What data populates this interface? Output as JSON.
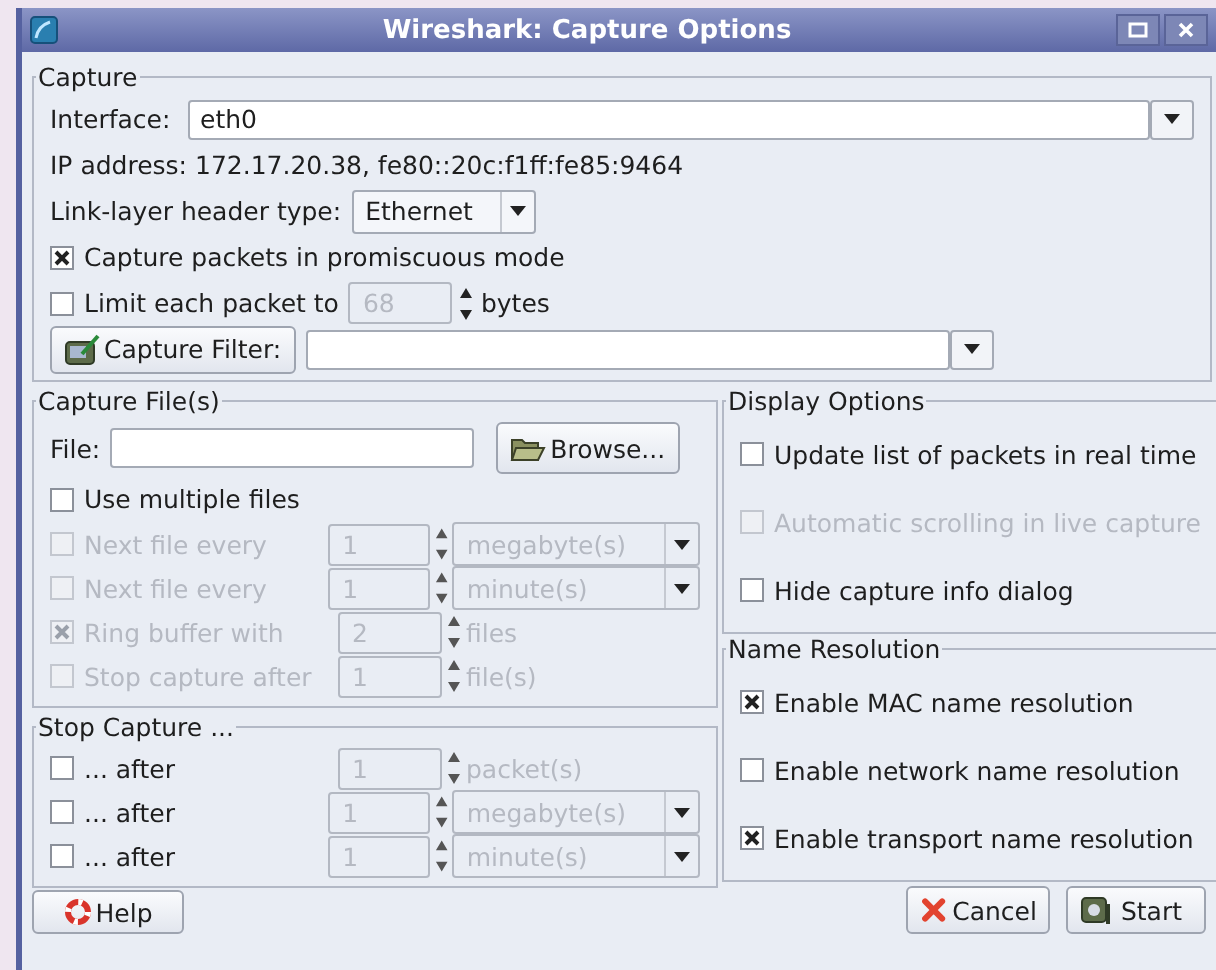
{
  "window": {
    "title": "Wireshark: Capture Options"
  },
  "capture": {
    "legend": "Capture",
    "interface": {
      "label": "Interface:",
      "value": "eth0"
    },
    "ip_address": "IP address: 172.17.20.38, fe80::20c:f1ff:fe85:9464",
    "link_layer": {
      "label": "Link-layer header type:",
      "value": "Ethernet"
    },
    "promiscuous": {
      "label": "Capture packets in promiscuous mode",
      "checked": true
    },
    "limit": {
      "label": "Limit each packet to",
      "checked": false,
      "value": "68",
      "value_disabled": true,
      "unit": "bytes"
    },
    "filter": {
      "button": "Capture Filter:"
    }
  },
  "capture_files": {
    "legend": "Capture File(s)",
    "file": {
      "label": "File:",
      "button": "Browse..."
    },
    "multiple": {
      "label": "Use multiple files",
      "checked": false
    },
    "rows": [
      {
        "label": "Next file every",
        "checked": false,
        "disabled": true,
        "value": "1",
        "unit": {
          "kind": "combo",
          "text": "megabyte(s)"
        }
      },
      {
        "label": "Next file every",
        "checked": false,
        "disabled": true,
        "value": "1",
        "unit": {
          "kind": "combo",
          "text": "minute(s)"
        }
      },
      {
        "label": "Ring buffer with",
        "checked": true,
        "disabled": true,
        "value": "2",
        "unit": {
          "kind": "text",
          "text": "files"
        }
      },
      {
        "label": "Stop capture after",
        "checked": false,
        "disabled": true,
        "value": "1",
        "unit": {
          "kind": "text",
          "text": "file(s)"
        }
      }
    ]
  },
  "stop_capture": {
    "legend": "Stop Capture ...",
    "rows": [
      {
        "label": "... after",
        "checked": false,
        "disabled": false,
        "value": "1",
        "unit": {
          "kind": "text",
          "text": "packet(s)"
        }
      },
      {
        "label": "... after",
        "checked": false,
        "disabled": false,
        "value": "1",
        "unit": {
          "kind": "combo",
          "text": "megabyte(s)"
        }
      },
      {
        "label": "... after",
        "checked": false,
        "disabled": false,
        "value": "1",
        "unit": {
          "kind": "combo",
          "text": "minute(s)"
        }
      }
    ]
  },
  "display_options": {
    "legend": "Display Options",
    "items": [
      {
        "label": "Update list of packets in real time",
        "checked": false,
        "disabled": false
      },
      {
        "label": "Automatic scrolling in live capture",
        "checked": false,
        "disabled": true
      },
      {
        "label": "Hide capture info dialog",
        "checked": false,
        "disabled": false
      }
    ]
  },
  "name_resolution": {
    "legend": "Name Resolution",
    "items": [
      {
        "label": "Enable MAC name resolution",
        "checked": true,
        "disabled": false
      },
      {
        "label": "Enable network name resolution",
        "checked": false,
        "disabled": false
      },
      {
        "label": "Enable transport name resolution",
        "checked": true,
        "disabled": false
      }
    ]
  },
  "buttons": {
    "help": "Help",
    "cancel": "Cancel",
    "start": "Start"
  }
}
